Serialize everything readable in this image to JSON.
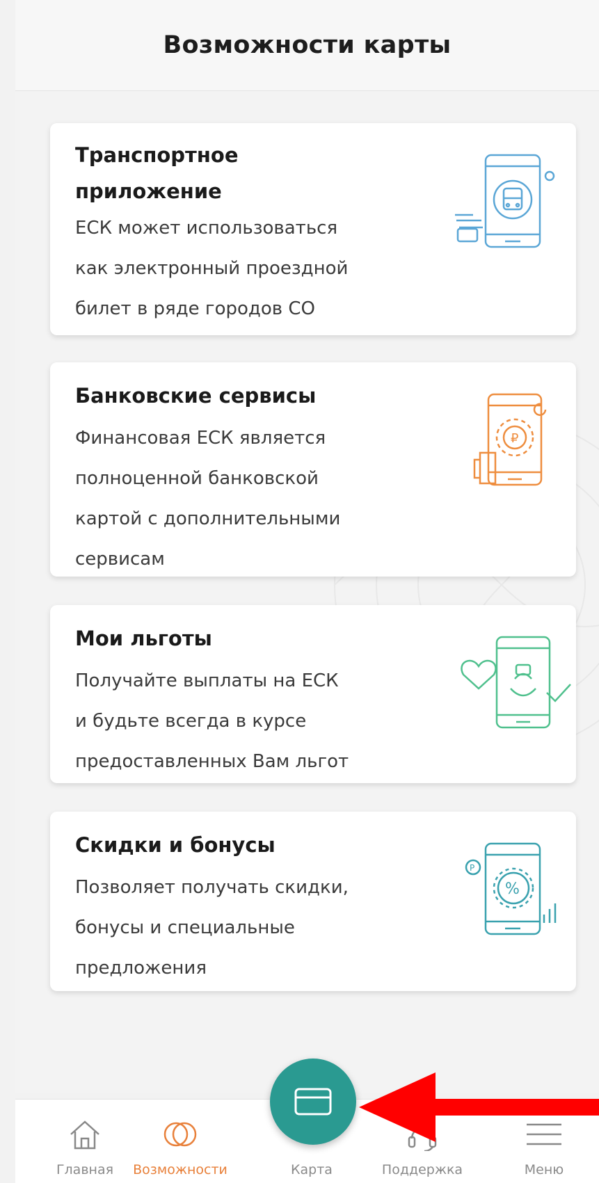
{
  "header": {
    "title": "Возможности карты"
  },
  "cards": [
    {
      "title_lines": [
        "Транспортное",
        "приложение"
      ],
      "text_lines": [
        "ЕСК может использоваться",
        "как электронный проездной",
        "билет в ряде городов СО"
      ],
      "icon": "transport-phone-icon",
      "accent": "#5aa6d6"
    },
    {
      "title_lines": [
        "Банковские сервисы"
      ],
      "text_lines": [
        "Финансовая ЕСК является",
        "полноценной банковской",
        "картой с дополнительными",
        "сервисам"
      ],
      "icon": "banking-phone-icon",
      "accent": "#ee8d3e"
    },
    {
      "title_lines": [
        "Мои льготы"
      ],
      "text_lines": [
        "Получайте выплаты на ЕСК",
        "и будьте всегда в курсе",
        "предоставленных Вам льгот"
      ],
      "icon": "benefits-phone-icon",
      "accent": "#4fc08d"
    },
    {
      "title_lines": [
        "Скидки и бонусы"
      ],
      "text_lines": [
        "Позволяет получать скидки,",
        "бонусы и специальные",
        "предложения"
      ],
      "icon": "discounts-phone-icon",
      "accent": "#39a1ae"
    }
  ],
  "nav": {
    "items": [
      {
        "label": "Главная",
        "icon": "home-icon",
        "active": false
      },
      {
        "label": "Возможности",
        "icon": "features-icon",
        "active": true
      },
      {
        "label": "Карта",
        "icon": "card-icon",
        "active": false
      },
      {
        "label": "Поддержка",
        "icon": "support-headset-icon",
        "active": false
      },
      {
        "label": "Меню",
        "icon": "menu-icon",
        "active": false
      }
    ]
  },
  "colors": {
    "accent_orange": "#e8803a",
    "fab_teal": "#2a9a91",
    "annotation_arrow": "#ff0000"
  }
}
